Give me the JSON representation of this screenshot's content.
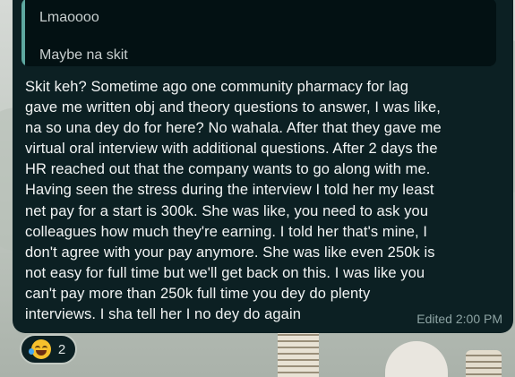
{
  "quoted_message": {
    "previous_line": "Lmaoooo",
    "text": "Maybe na skit"
  },
  "message": {
    "text": "Skit keh? Sometime ago one community pharmacy for lag\ngave me written obj and theory questions to answer, I was like,\nna so una dey do for here? No wahala. After that they gave me\nvirtual oral interview with additional questions. After 2 days the\nHR reached out that the company wants to go along with me.\nHaving seen the stress during the interview I told her my least\nnet pay for a start is 300k. She was like, you need to ask you\ncolleagues how much they're earning. I told her that's mine, I\ndon't agree with your pay anymore. She was like even 250k is\nnot easy for full time but we'll get back on this. I was like you\ncan't pay more than 250k full time you dey do plenty\ninterviews. I sha tell her I no dey do again",
    "meta": "Edited  2:00 PM"
  },
  "reaction": {
    "emoji": "face-with-tears-of-joy",
    "count": "2"
  },
  "colors": {
    "bubble": "#0c2023",
    "quote_bg": "#031113",
    "quote_bar": "#5ea8a0",
    "text": "#f2f4f4",
    "meta": "#8da3a3"
  }
}
